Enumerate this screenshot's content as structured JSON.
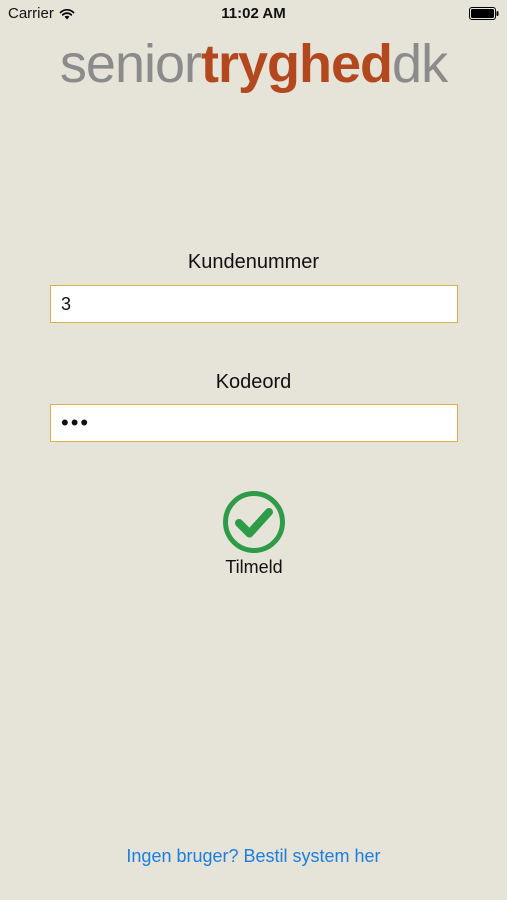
{
  "status_bar": {
    "carrier": "Carrier",
    "time": "11:02 AM",
    "wifi_icon": "wifi-icon",
    "battery_icon": "battery-icon"
  },
  "logo": {
    "part1": "senior",
    "part2": "tryghed",
    "part3": "dk",
    "colors": {
      "light": "#8b8b8b",
      "accent": "#b3481f"
    }
  },
  "form": {
    "customer_label": "Kundenummer",
    "customer_value": "3",
    "password_label": "Kodeord",
    "password_value": "•••",
    "submit_label": "Tilmeld",
    "submit_icon": "check-circle-icon",
    "input_border_color": "#e2b048",
    "check_color": "#2e9b48"
  },
  "footer": {
    "signup_link": "Ingen bruger? Bestil system her",
    "link_color": "#1b7ee0"
  }
}
